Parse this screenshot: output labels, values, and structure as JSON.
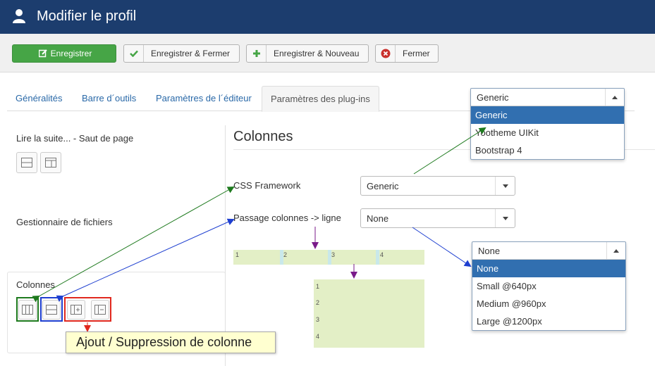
{
  "header": {
    "title": "Modifier le profil"
  },
  "toolbar": {
    "save": "Enregistrer",
    "save_close": "Enregistrer & Fermer",
    "save_new": "Enregistrer & Nouveau",
    "close": "Fermer"
  },
  "tabs": [
    {
      "label": "Généralités"
    },
    {
      "label": "Barre d´outils"
    },
    {
      "label": "Paramètres de l´éditeur"
    },
    {
      "label": "Paramètres des plug-ins"
    }
  ],
  "left": {
    "readmore_label": "Lire la suite... - Saut de page",
    "filemanager_label": "Gestionnaire de fichiers",
    "columns_label": "Colonnes"
  },
  "main": {
    "section_title": "Colonnes",
    "css_framework_label": "CSS Framework",
    "css_framework_value": "Generic",
    "passage_label": "Passage colonnes -> ligne",
    "passage_value": "None"
  },
  "framework_dropdown": {
    "selected": "Generic",
    "options": [
      "Generic",
      "Yootheme UIKit",
      "Bootstrap 4"
    ]
  },
  "passage_dropdown": {
    "selected": "None",
    "options": [
      "None",
      "Small @640px",
      "Medium @960px",
      "Large @1200px"
    ]
  },
  "preview": {
    "row_cells": [
      "1",
      "2",
      "3",
      "4"
    ],
    "col_cells": [
      "1",
      "2",
      "3",
      "4"
    ]
  },
  "tooltip": {
    "text": "Ajout / Suppression de colonne"
  },
  "colors": {
    "header_bg": "#1c3d6e",
    "save_button": "#46a546",
    "selected_option": "#316fb0",
    "preview_bg": "#e3efc6",
    "arrow_green": "#1e7a1e",
    "arrow_blue": "#1e3fd0",
    "arrow_red": "#e0281e",
    "arrow_purple": "#7a1a8a"
  }
}
